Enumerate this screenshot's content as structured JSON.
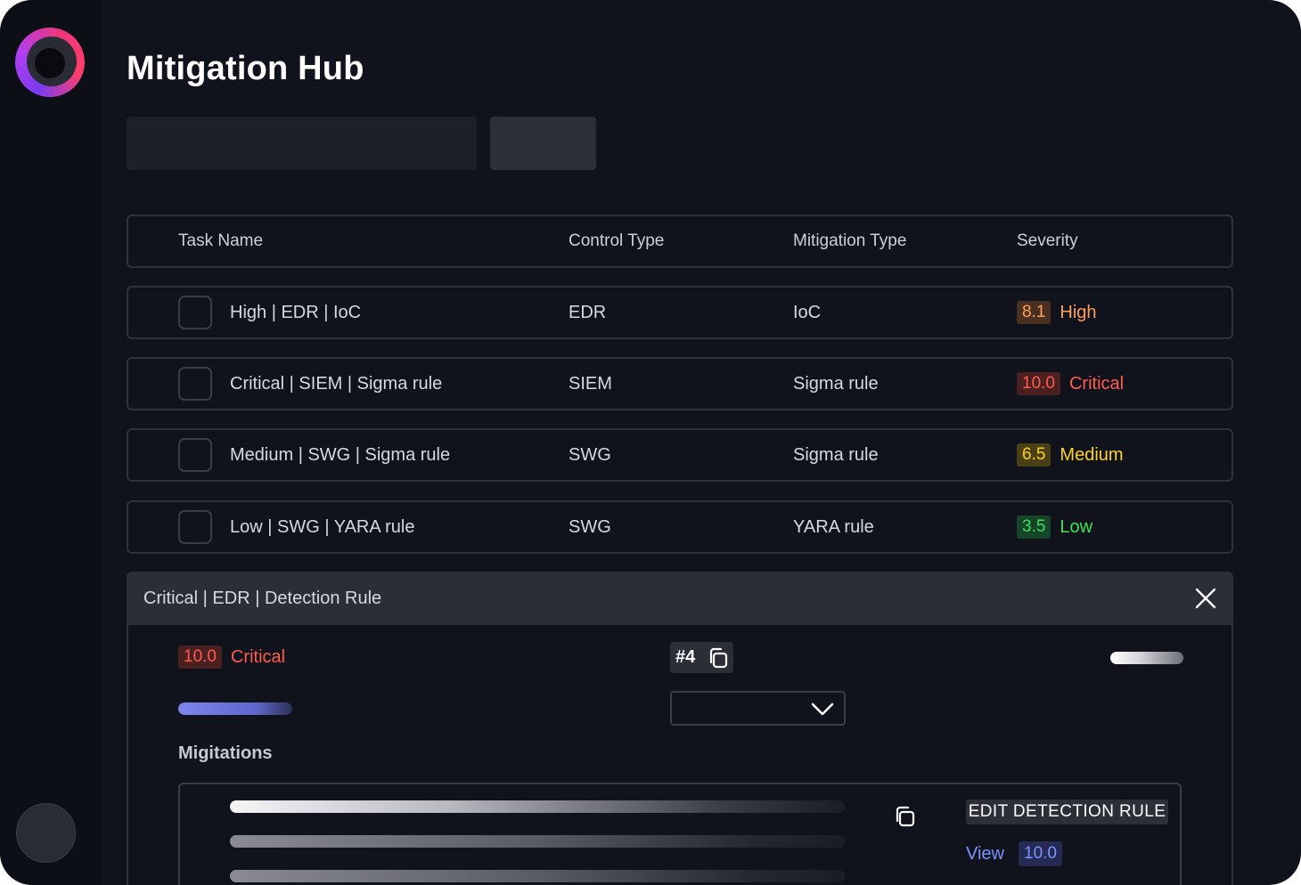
{
  "app": {
    "title": "Mitigation Hub"
  },
  "colors": {
    "background": "#11131c",
    "high": "#ff9e57",
    "high_bg": "#4a3020",
    "critical": "#ff5b4f",
    "critical_bg": "#4a2020",
    "medium": "#ffd21f",
    "medium_bg": "#4a4016",
    "low": "#3ee05a",
    "low_bg": "#17452a",
    "link": "#7c92ff"
  },
  "table": {
    "headers": [
      "Task Name",
      "Control Type",
      "Mitigation Type",
      "Severity"
    ],
    "rows": [
      {
        "task": "High | EDR | IoC",
        "control": "EDR",
        "mitigation": "IoC",
        "score": "8.1",
        "severity": "High",
        "level": "high"
      },
      {
        "task": "Critical | SIEM | Sigma rule",
        "control": "SIEM",
        "mitigation": "Sigma rule",
        "score": "10.0",
        "severity": "Critical",
        "level": "critical"
      },
      {
        "task": "Medium | SWG | Sigma rule",
        "control": "SWG",
        "mitigation": "Sigma rule",
        "score": "6.5",
        "severity": "Medium",
        "level": "medium"
      },
      {
        "task": "Low | SWG | YARA rule",
        "control": "SWG",
        "mitigation": "YARA rule",
        "score": "3.5",
        "severity": "Low",
        "level": "low"
      }
    ]
  },
  "detail": {
    "title": "Critical | EDR | Detection Rule",
    "score": "10.0",
    "severity": "Critical",
    "id": "#4",
    "progress": 1.0,
    "section_label": "Migitations",
    "edit_label": "EDIT DETECTION RULE",
    "view_label": "View",
    "view_score": "10.0"
  },
  "icons": {
    "logo": "app-logo-icon",
    "close": "close-icon",
    "copy": "copy-icon",
    "chevron": "chevron-down-icon",
    "avatar": "user-avatar"
  }
}
